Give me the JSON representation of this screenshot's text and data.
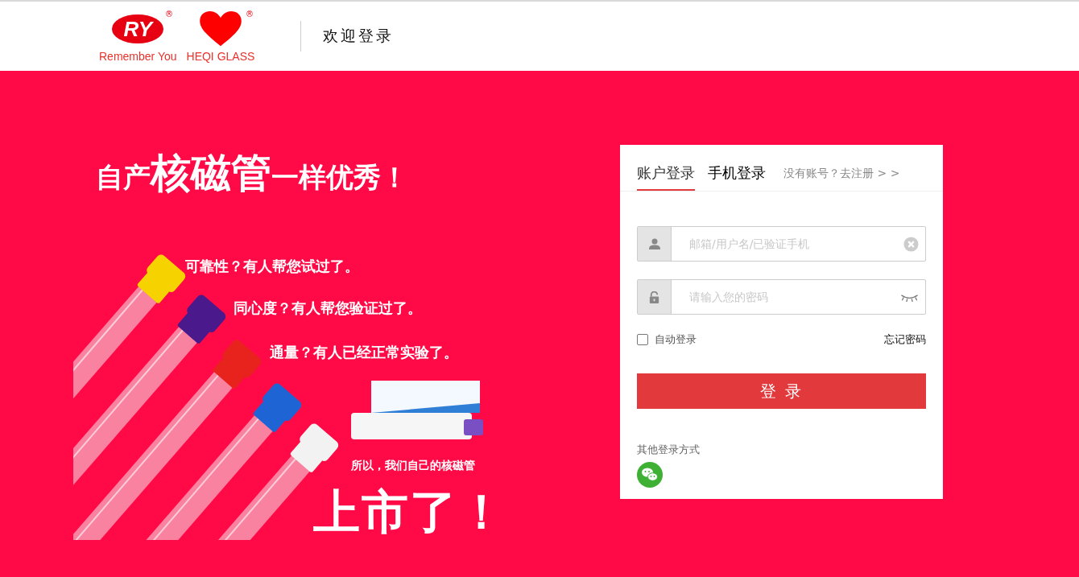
{
  "header": {
    "logo": {
      "mark": "RY",
      "registered": "®",
      "tagline": "Remember You"
    },
    "brand": {
      "registered": "®",
      "name": "HEQI GLASS"
    },
    "title": "欢迎登录"
  },
  "banner": {
    "headline": {
      "before": "自产",
      "emphasis": "核磁管",
      "after": "一样优秀！"
    },
    "claims": [
      "可靠性？有人帮您试过了。",
      "同心度？有人帮您验证过了。",
      "通量？有人已经正常实验了。"
    ],
    "subline": "所以，我们自己的核磁管",
    "slogan": "上市了！"
  },
  "login": {
    "tabs": [
      {
        "label": "账户登录",
        "selected": true
      },
      {
        "label": "手机登录",
        "selected": false
      }
    ],
    "register_link": "没有账号？去注册 > >",
    "username": {
      "placeholder": "邮箱/用户名/已验证手机"
    },
    "password": {
      "placeholder": "请输入您的密码"
    },
    "remember": {
      "label": "自动登录",
      "checked": false
    },
    "forgot": "忘记密码",
    "submit": "登 录",
    "other_label": "其他登录方式"
  }
}
